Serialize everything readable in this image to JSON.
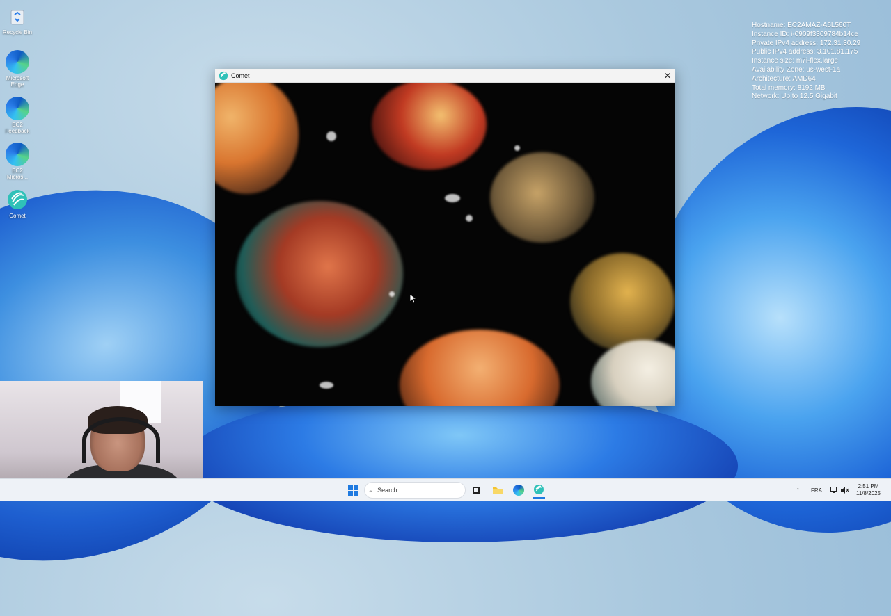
{
  "desktop": {
    "icons": [
      {
        "label": "Recycle Bin",
        "icon": "recycle-bin-icon"
      },
      {
        "label": "Microsoft Edge",
        "icon": "edge-icon"
      },
      {
        "label": "EC2 Feedback",
        "icon": "edge-icon"
      },
      {
        "label": "EC2 Micros...",
        "icon": "edge-icon"
      },
      {
        "label": "Comet",
        "icon": "comet-icon"
      }
    ]
  },
  "sysinfo": {
    "lines": [
      "Hostname: EC2AMAZ-A6L560T",
      "Instance ID: i-0909f3309784b14ce",
      "Private IPv4 address: 172.31.30.29",
      "Public IPv4 address: 3.101.81.175",
      "Instance size: m7i-flex.large",
      "Availability Zone: us-west-1a",
      "Architecture: AMD64",
      "Total memory: 8192 MB",
      "Network: Up to 12.5 Gigabit"
    ]
  },
  "window": {
    "title": "Comet",
    "close_symbol": "✕"
  },
  "taskbar": {
    "search_placeholder": "Search",
    "language": "FRA",
    "time": "2:51 PM",
    "date": "11/8/2025",
    "chevron": "⌃"
  },
  "colors": {
    "accent": "#1f7ae0",
    "taskbar_bg": "#eef2f7"
  }
}
